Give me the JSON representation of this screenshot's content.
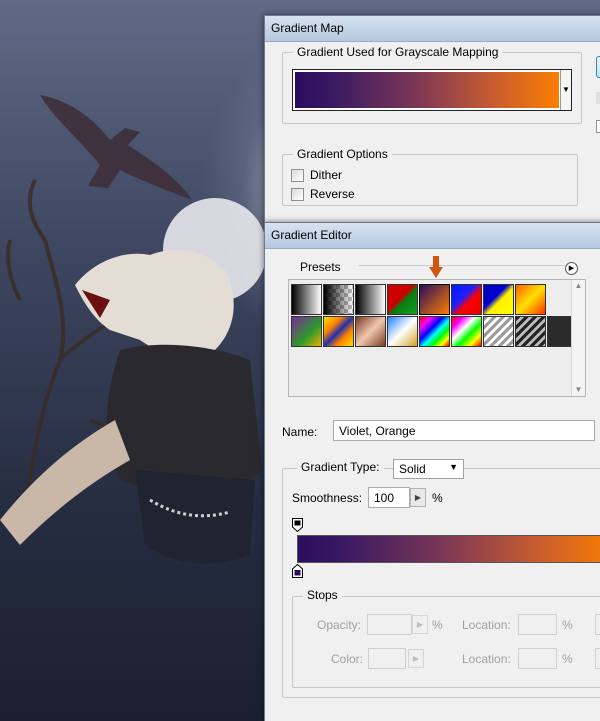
{
  "gradient_map": {
    "title": "Gradient Map",
    "used_for_label": "Gradient Used for Grayscale Mapping",
    "options_label": "Gradient Options",
    "dither_label": "Dither",
    "reverse_label": "Reverse",
    "dither_checked": false,
    "reverse_checked": false
  },
  "gradient_editor": {
    "title": "Gradient Editor",
    "presets_label": "Presets",
    "name_label": "Name:",
    "name_value": "Violet, Orange",
    "gradient_type_label": "Gradient Type:",
    "gradient_type_value": "Solid",
    "smoothness_label": "Smoothness:",
    "smoothness_value": "100",
    "percent": "%",
    "stops_label": "Stops",
    "opacity_label": "Opacity:",
    "location_label": "Location:",
    "color_label": "Color:",
    "selected_preset": "Violet, Orange"
  },
  "colors": {
    "gradient_start": "#2a0d5e",
    "gradient_end": "#fb7e00",
    "preset_arrow": "#d0560f"
  },
  "icons": {
    "menu": "circle-arrow-right-icon",
    "dropdown": "chevron-down-icon",
    "stepper": "triangle-right-icon"
  }
}
